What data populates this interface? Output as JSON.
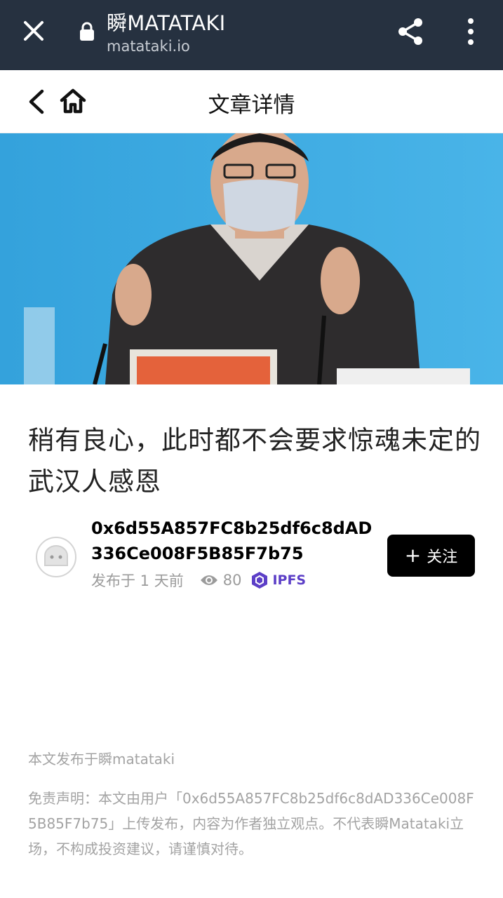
{
  "browser": {
    "site_title": "瞬MATATAKI",
    "site_url": "matataki.io"
  },
  "header": {
    "title": "文章详情"
  },
  "article": {
    "title": "稍有良心，此时都不会要求惊魂未定的武汉人感恩",
    "author": "0x6d55A857FC8b25df6c8dAD336Ce008F5B85F7b75",
    "published": "发布于 1 天前",
    "views": "80",
    "ipfs_label": "IPFS",
    "follow_label": "关注"
  },
  "footer": {
    "published_on": "本文发布于瞬matataki",
    "disclaimer": "免责声明：本文由用户「0x6d55A857FC8b25df6c8dAD336Ce008F5B85F7b75」上传发布，内容为作者独立观点。不代表瞬Matataki立场，不构成投资建议，请谨慎对待。"
  },
  "colors": {
    "browser_bar": "#263140",
    "follow_button": "#000000",
    "ipfs_accent": "#5c3fc7",
    "hero_background": "#3aa8e0"
  }
}
